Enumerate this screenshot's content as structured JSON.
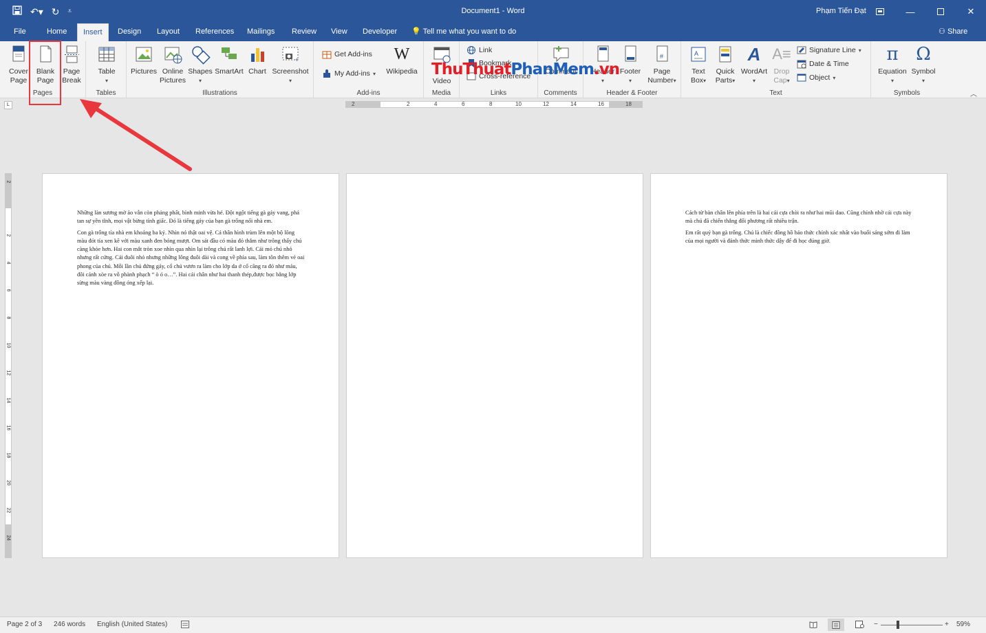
{
  "window": {
    "title": "Document1  -  Word",
    "user": "Phạm Tiến Đạt"
  },
  "tabs": [
    "File",
    "Home",
    "Insert",
    "Design",
    "Layout",
    "References",
    "Mailings",
    "Review",
    "View",
    "Developer"
  ],
  "active_tab": "Insert",
  "tell_me": "Tell me what you want to do",
  "share": "Share",
  "ribbon": {
    "pages": {
      "label": "Pages",
      "cover": [
        "Cover",
        "Page"
      ],
      "blank": [
        "Blank",
        "Page"
      ],
      "break": [
        "Page",
        "Break"
      ]
    },
    "tables": {
      "label": "Tables",
      "table": "Table"
    },
    "illustrations": {
      "label": "Illustrations",
      "pictures": "Pictures",
      "online": [
        "Online",
        "Pictures"
      ],
      "shapes": "Shapes",
      "smartart": "SmartArt",
      "chart": "Chart",
      "screenshot": "Screenshot"
    },
    "addins": {
      "label": "Add-ins",
      "get": "Get Add-ins",
      "my": "My Add-ins",
      "wikipedia": "Wikipedia"
    },
    "media": {
      "label": "Media",
      "video": "Video"
    },
    "links": {
      "label": "Links",
      "link": "Link",
      "bookmark": "Bookmark",
      "cross": "Cross-reference"
    },
    "comments": {
      "label": "Comments",
      "comment": "Comment"
    },
    "header_footer": {
      "label": "Header & Footer",
      "header": "Header",
      "footer": "Footer",
      "page_number": [
        "Page",
        "Number"
      ]
    },
    "text": {
      "label": "Text",
      "textbox": [
        "Text",
        "Box"
      ],
      "quickparts": [
        "Quick",
        "Parts"
      ],
      "wordart": "WordArt",
      "dropcap": [
        "Drop",
        "Cap"
      ],
      "signature": "Signature Line",
      "datetime": "Date & Time",
      "object": "Object"
    },
    "symbols": {
      "label": "Symbols",
      "equation": "Equation",
      "symbol": "Symbol"
    }
  },
  "watermark": {
    "part1": "ThuThuat",
    "part2": "PhanMem",
    "part3": ".vn"
  },
  "ruler": {
    "h": [
      "2",
      "2",
      "4",
      "6",
      "8",
      "10",
      "12",
      "14",
      "16",
      "18"
    ],
    "v": [
      "2",
      "2",
      "4",
      "6",
      "8",
      "10",
      "12",
      "14",
      "16",
      "18",
      "20",
      "22",
      "24"
    ]
  },
  "pages": [
    {
      "paragraphs": [
        "Những làn sương mờ ảo vẫn còn phảng phất, bình minh vừa hé. Đột ngột tiếng gà gáy vang, phá tan sự yên tĩnh, mọi vật bừng tỉnh giấc. Đó là tiếng gáy của bạn gà trống nổi nhà em.",
        "Con gà trống tía nhà em khoảng ba ký. Nhìn nó thật oai vệ. Cả thân hình trùm lên một bộ lông màu đỏt tía xen kẽ với màu xanh đen bóng mượt. Om sát đầu có màu đỏ thắm như trông thấy chú càng khỏe hơn. Hai con mắt tròn xoe nhìn qua nhìn lại trông chú rất lanh lợi. Cái mỏ chú nhỏ nhưng rất cứng. Cái đuôi nhỏ nhưng những lông đuôi dài và cong về phía sau, làm tôn thêm vẻ oai phong của chú. Mỗi lần chú đứng gáy, cổ chú vươn ra làm cho lớp da ở cổ căng ra đỏ như máu, đôi cánh xòe ra vỗ phành phạch “ ò ó o…”. Hai cái chân như hai thanh thép,được bọc bằng lớp sừng màu vàng đồng óng xếp lại."
      ]
    },
    {
      "paragraphs": []
    },
    {
      "paragraphs": [
        "Cách từ bàn chân lên phía trên là hai cái cựa chòi ra như hai mũi dao. Cũng chính nhờ cái cựa này mà chú đã chiến thắng đối phương rất nhiều trận.",
        "Em rất quý bạn gà trống. Chú là chiếc đồng hồ báo thức chính xác nhất vào buổi sáng sớm đi làm của mọi người và đánh thức mình thức dậy để đi học đúng giờ."
      ]
    }
  ],
  "status": {
    "page": "Page 2 of 3",
    "words": "246 words",
    "language": "English (United States)",
    "zoom": "59%",
    "zoom_level": 0.59
  },
  "colors": {
    "brand": "#2b579a",
    "highlight": "#e8383d"
  }
}
